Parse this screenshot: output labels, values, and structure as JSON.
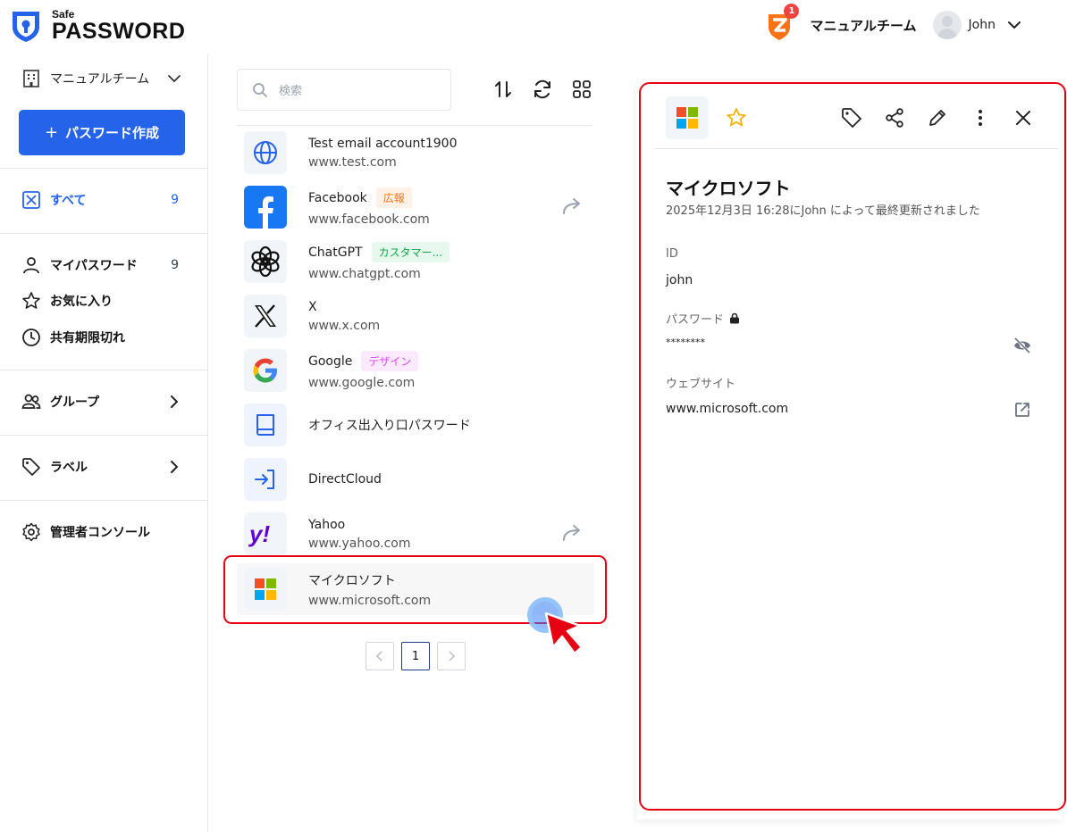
{
  "app": {
    "logo_small": "Safe",
    "logo_big": "PASSWORD",
    "brand_color": "#2563eb"
  },
  "header": {
    "notification_count": "1",
    "team_name": "マニュアルチーム",
    "user_name": "John"
  },
  "sidebar": {
    "team_select": "マニュアルチーム",
    "create_button": "パスワード作成",
    "create_button_icon": "+",
    "items": [
      {
        "label": "すべて",
        "count": "9",
        "icon": "all-icon"
      },
      {
        "label": "マイパスワード",
        "count": "9",
        "icon": "user-icon"
      },
      {
        "label": "お気に入り",
        "icon": "star-icon"
      },
      {
        "label": "共有期限切れ",
        "icon": "clock-icon"
      },
      {
        "label": "グループ",
        "icon": "group-icon"
      },
      {
        "label": "ラベル",
        "icon": "tag-icon"
      },
      {
        "label": "管理者コンソール",
        "icon": "gear-icon"
      }
    ]
  },
  "list": {
    "search_placeholder": "検索",
    "items": [
      {
        "title": "Test email account1900",
        "url": "www.test.com",
        "icon": "globe-icon"
      },
      {
        "title": "Facebook",
        "url": "www.facebook.com",
        "tag": "広報",
        "tag_color": "#f97316",
        "tag_bg": "#fff1e6",
        "shared": true,
        "icon": "facebook-icon"
      },
      {
        "title": "ChatGPT",
        "url": "www.chatgpt.com",
        "tag": "カスタマー...",
        "tag_color": "#16a34a",
        "tag_bg": "#e7f8ee",
        "icon": "chatgpt-icon"
      },
      {
        "title": "X",
        "url": "www.x.com",
        "icon": "x-icon"
      },
      {
        "title": "Google",
        "url": "www.google.com",
        "tag": "デザイン",
        "tag_color": "#d946ef",
        "tag_bg": "#fbeafe",
        "icon": "google-icon"
      },
      {
        "title": "オフィス出入り口パスワード",
        "icon": "book-icon"
      },
      {
        "title": "DirectCloud",
        "icon": "login-icon"
      },
      {
        "title": "Yahoo",
        "url": "www.yahoo.com",
        "shared": true,
        "icon": "yahoo-icon"
      },
      {
        "title": "マイクロソフト",
        "url": "www.microsoft.com",
        "selected": true,
        "icon": "microsoft-icon"
      }
    ],
    "pagination": {
      "current": "1"
    }
  },
  "detail": {
    "title": "マイクロソフト",
    "updated": "2025年12月3日 16:28にJohn によって最終更新されました",
    "id_label": "ID",
    "id_value": "john",
    "password_label": "パスワード",
    "password_value": "********",
    "website_label": "ウェブサイト",
    "website_value": "www.microsoft.com"
  },
  "annotation": {
    "highlight_color": "#e60012"
  }
}
